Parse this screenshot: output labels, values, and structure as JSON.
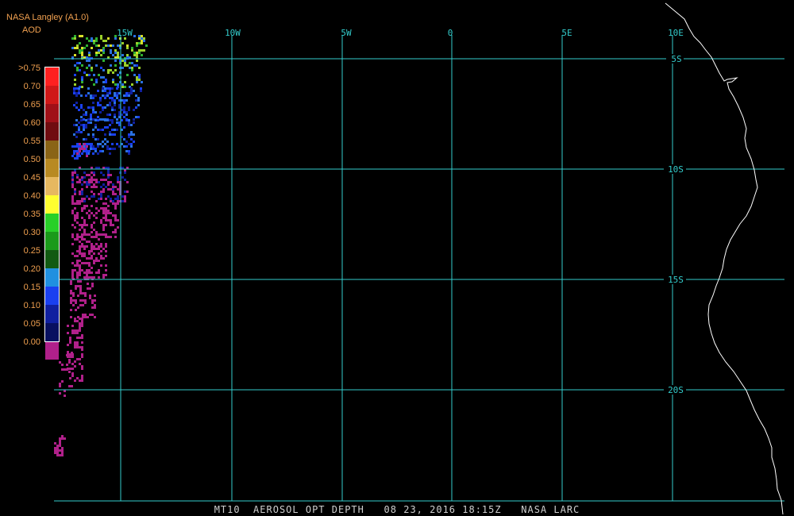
{
  "header": {
    "title": "NASA Langley (A1.0)",
    "units": "AOD"
  },
  "colors": {
    "background": "#000000",
    "grid": "#33cccc",
    "text_orange": "#f0a050",
    "coast": "#ffffff",
    "caption": "#cfcfcf"
  },
  "legend": {
    "entries": [
      {
        "label": ">0.75",
        "color": "#ff2020"
      },
      {
        "label": "0.70",
        "color": "#d01818"
      },
      {
        "label": "0.65",
        "color": "#a01018"
      },
      {
        "label": "0.60",
        "color": "#700c10"
      },
      {
        "label": "0.55",
        "color": "#8a6416"
      },
      {
        "label": "0.50",
        "color": "#b88a22"
      },
      {
        "label": "0.45",
        "color": "#e6b860"
      },
      {
        "label": "0.40",
        "color": "#ffff30"
      },
      {
        "label": "0.35",
        "color": "#28d028"
      },
      {
        "label": "0.30",
        "color": "#1a9a1a"
      },
      {
        "label": "0.25",
        "color": "#125a12"
      },
      {
        "label": "0.20",
        "color": "#2090e0"
      },
      {
        "label": "0.15",
        "color": "#1a40f0"
      },
      {
        "label": "0.10",
        "color": "#1020a0"
      },
      {
        "label": "0.05",
        "color": "#081060"
      },
      {
        "label": "0.00",
        "color": "#b0208a"
      }
    ]
  },
  "longitude_labels": [
    "15W",
    "10W",
    "5W",
    "0",
    "5E",
    "10E"
  ],
  "latitude_labels": [
    "5S",
    "10S",
    "15S",
    "20S"
  ],
  "caption": "MT10  AEROSOL OPT DEPTH   08 23, 2016 18:15Z   NASA LARC"
}
